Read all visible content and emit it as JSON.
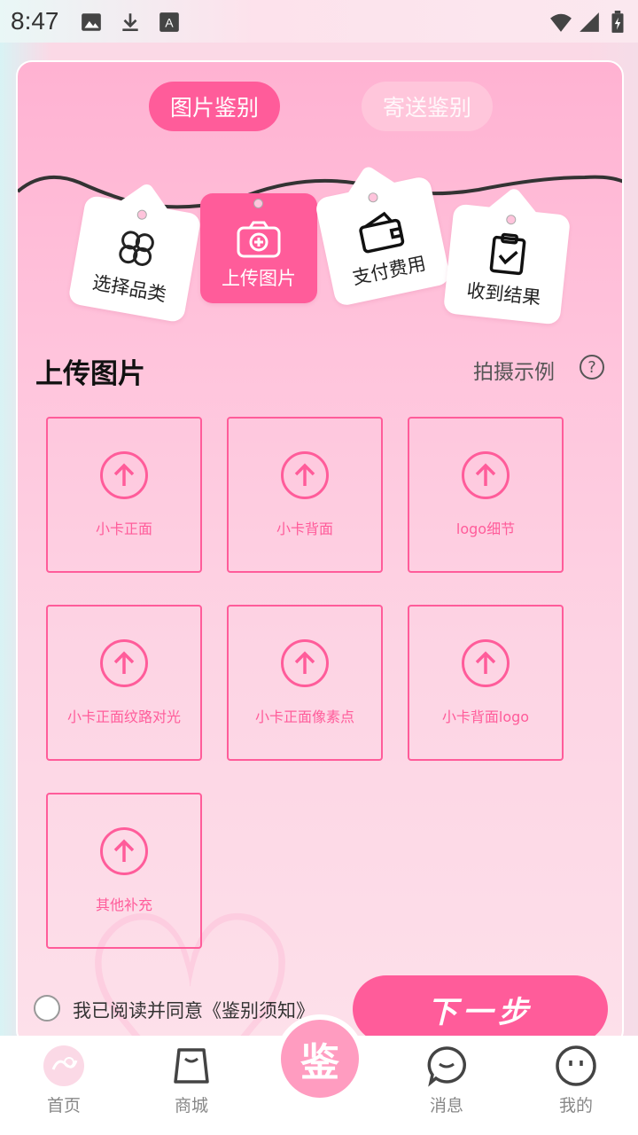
{
  "status_bar": {
    "time": "8:47"
  },
  "tabs": {
    "active": "图片鉴别",
    "inactive": "寄送鉴别"
  },
  "steps": [
    {
      "label": "选择品类",
      "icon": "clover-icon"
    },
    {
      "label": "上传图片",
      "icon": "camera-icon"
    },
    {
      "label": "支付费用",
      "icon": "wallet-icon"
    },
    {
      "label": "收到结果",
      "icon": "clipboard-check-icon"
    }
  ],
  "section": {
    "title": "上传图片",
    "example": "拍摄示例",
    "help": "?"
  },
  "uploads": [
    "小卡正面",
    "小卡背面",
    "logo细节",
    "小卡正面纹路对光",
    "小卡正面像素点",
    "小卡背面logo",
    "其他补充"
  ],
  "agreement": {
    "text": "我已阅读并同意《鉴别须知》"
  },
  "next_button": "下一步",
  "nav": {
    "home": "首页",
    "mall": "商城",
    "center": "鉴",
    "messages": "消息",
    "mine": "我的"
  },
  "colors": {
    "accent": "#ff5c9a",
    "card_bg": "#ffc4dc"
  }
}
